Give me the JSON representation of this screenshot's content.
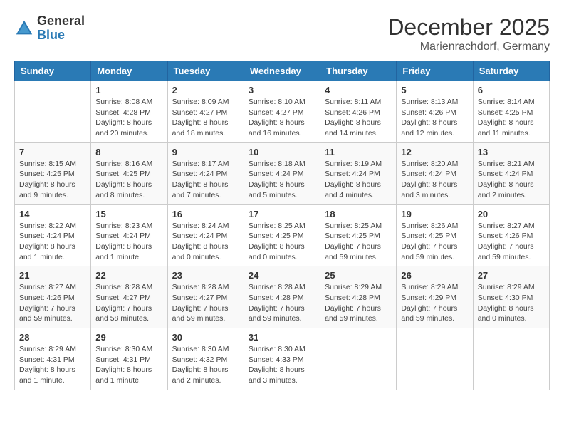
{
  "header": {
    "logo_general": "General",
    "logo_blue": "Blue",
    "month": "December 2025",
    "location": "Marienrachdorf, Germany"
  },
  "weekdays": [
    "Sunday",
    "Monday",
    "Tuesday",
    "Wednesday",
    "Thursday",
    "Friday",
    "Saturday"
  ],
  "weeks": [
    [
      {
        "day": "",
        "info": ""
      },
      {
        "day": "1",
        "info": "Sunrise: 8:08 AM\nSunset: 4:28 PM\nDaylight: 8 hours\nand 20 minutes."
      },
      {
        "day": "2",
        "info": "Sunrise: 8:09 AM\nSunset: 4:27 PM\nDaylight: 8 hours\nand 18 minutes."
      },
      {
        "day": "3",
        "info": "Sunrise: 8:10 AM\nSunset: 4:27 PM\nDaylight: 8 hours\nand 16 minutes."
      },
      {
        "day": "4",
        "info": "Sunrise: 8:11 AM\nSunset: 4:26 PM\nDaylight: 8 hours\nand 14 minutes."
      },
      {
        "day": "5",
        "info": "Sunrise: 8:13 AM\nSunset: 4:26 PM\nDaylight: 8 hours\nand 12 minutes."
      },
      {
        "day": "6",
        "info": "Sunrise: 8:14 AM\nSunset: 4:25 PM\nDaylight: 8 hours\nand 11 minutes."
      }
    ],
    [
      {
        "day": "7",
        "info": "Sunrise: 8:15 AM\nSunset: 4:25 PM\nDaylight: 8 hours\nand 9 minutes."
      },
      {
        "day": "8",
        "info": "Sunrise: 8:16 AM\nSunset: 4:25 PM\nDaylight: 8 hours\nand 8 minutes."
      },
      {
        "day": "9",
        "info": "Sunrise: 8:17 AM\nSunset: 4:24 PM\nDaylight: 8 hours\nand 7 minutes."
      },
      {
        "day": "10",
        "info": "Sunrise: 8:18 AM\nSunset: 4:24 PM\nDaylight: 8 hours\nand 5 minutes."
      },
      {
        "day": "11",
        "info": "Sunrise: 8:19 AM\nSunset: 4:24 PM\nDaylight: 8 hours\nand 4 minutes."
      },
      {
        "day": "12",
        "info": "Sunrise: 8:20 AM\nSunset: 4:24 PM\nDaylight: 8 hours\nand 3 minutes."
      },
      {
        "day": "13",
        "info": "Sunrise: 8:21 AM\nSunset: 4:24 PM\nDaylight: 8 hours\nand 2 minutes."
      }
    ],
    [
      {
        "day": "14",
        "info": "Sunrise: 8:22 AM\nSunset: 4:24 PM\nDaylight: 8 hours\nand 1 minute."
      },
      {
        "day": "15",
        "info": "Sunrise: 8:23 AM\nSunset: 4:24 PM\nDaylight: 8 hours\nand 1 minute."
      },
      {
        "day": "16",
        "info": "Sunrise: 8:24 AM\nSunset: 4:24 PM\nDaylight: 8 hours\nand 0 minutes."
      },
      {
        "day": "17",
        "info": "Sunrise: 8:25 AM\nSunset: 4:25 PM\nDaylight: 8 hours\nand 0 minutes."
      },
      {
        "day": "18",
        "info": "Sunrise: 8:25 AM\nSunset: 4:25 PM\nDaylight: 7 hours\nand 59 minutes."
      },
      {
        "day": "19",
        "info": "Sunrise: 8:26 AM\nSunset: 4:25 PM\nDaylight: 7 hours\nand 59 minutes."
      },
      {
        "day": "20",
        "info": "Sunrise: 8:27 AM\nSunset: 4:26 PM\nDaylight: 7 hours\nand 59 minutes."
      }
    ],
    [
      {
        "day": "21",
        "info": "Sunrise: 8:27 AM\nSunset: 4:26 PM\nDaylight: 7 hours\nand 59 minutes."
      },
      {
        "day": "22",
        "info": "Sunrise: 8:28 AM\nSunset: 4:27 PM\nDaylight: 7 hours\nand 58 minutes."
      },
      {
        "day": "23",
        "info": "Sunrise: 8:28 AM\nSunset: 4:27 PM\nDaylight: 7 hours\nand 59 minutes."
      },
      {
        "day": "24",
        "info": "Sunrise: 8:28 AM\nSunset: 4:28 PM\nDaylight: 7 hours\nand 59 minutes."
      },
      {
        "day": "25",
        "info": "Sunrise: 8:29 AM\nSunset: 4:28 PM\nDaylight: 7 hours\nand 59 minutes."
      },
      {
        "day": "26",
        "info": "Sunrise: 8:29 AM\nSunset: 4:29 PM\nDaylight: 7 hours\nand 59 minutes."
      },
      {
        "day": "27",
        "info": "Sunrise: 8:29 AM\nSunset: 4:30 PM\nDaylight: 8 hours\nand 0 minutes."
      }
    ],
    [
      {
        "day": "28",
        "info": "Sunrise: 8:29 AM\nSunset: 4:31 PM\nDaylight: 8 hours\nand 1 minute."
      },
      {
        "day": "29",
        "info": "Sunrise: 8:30 AM\nSunset: 4:31 PM\nDaylight: 8 hours\nand 1 minute."
      },
      {
        "day": "30",
        "info": "Sunrise: 8:30 AM\nSunset: 4:32 PM\nDaylight: 8 hours\nand 2 minutes."
      },
      {
        "day": "31",
        "info": "Sunrise: 8:30 AM\nSunset: 4:33 PM\nDaylight: 8 hours\nand 3 minutes."
      },
      {
        "day": "",
        "info": ""
      },
      {
        "day": "",
        "info": ""
      },
      {
        "day": "",
        "info": ""
      }
    ]
  ]
}
